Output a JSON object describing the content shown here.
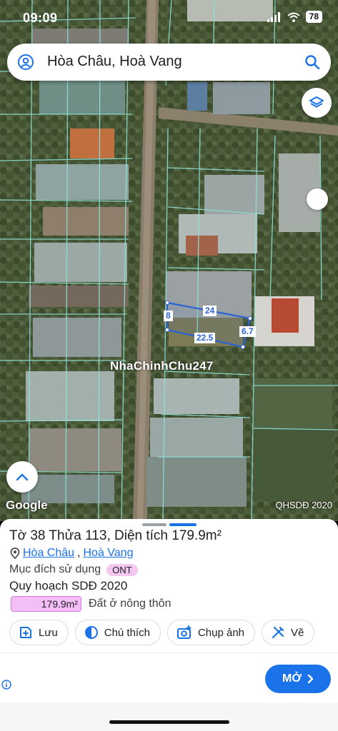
{
  "status_bar": {
    "time": "09:09",
    "battery": "78"
  },
  "search": {
    "query": "Hòa Châu, Hoà Vang"
  },
  "map": {
    "watermark": "NhaChinhChu247",
    "logo": "Google",
    "plan_tag": "QHSDĐ 2020",
    "dimensions": {
      "top": "24",
      "left": "8",
      "right": "6.7",
      "bottom": "22.5"
    }
  },
  "parcel": {
    "title": "Tờ 38 Thửa 113, Diện tích 179.9m²",
    "commune": "Hòa Châu",
    "separator": ",",
    "district": "Hoà Vang",
    "purpose_label": "Mục đích sử dụng",
    "purpose_code": "ONT",
    "plan_title": "Quy hoạch SDĐ 2020",
    "plan_area": "179.9m²",
    "plan_desc": "Đất ở nông thôn"
  },
  "actions": [
    {
      "label": "Lưu",
      "icon": "save-icon"
    },
    {
      "label": "Chú thích",
      "icon": "legend-icon"
    },
    {
      "label": "Chụp ảnh",
      "icon": "camera-icon"
    },
    {
      "label": "Vẽ",
      "icon": "draw-icon"
    }
  ],
  "ad": {
    "button_label": "MỞ"
  },
  "colors": {
    "accent": "#1a73e8",
    "plan_pink": "#f4bef6",
    "parcel_outline": "#2b63d6"
  }
}
